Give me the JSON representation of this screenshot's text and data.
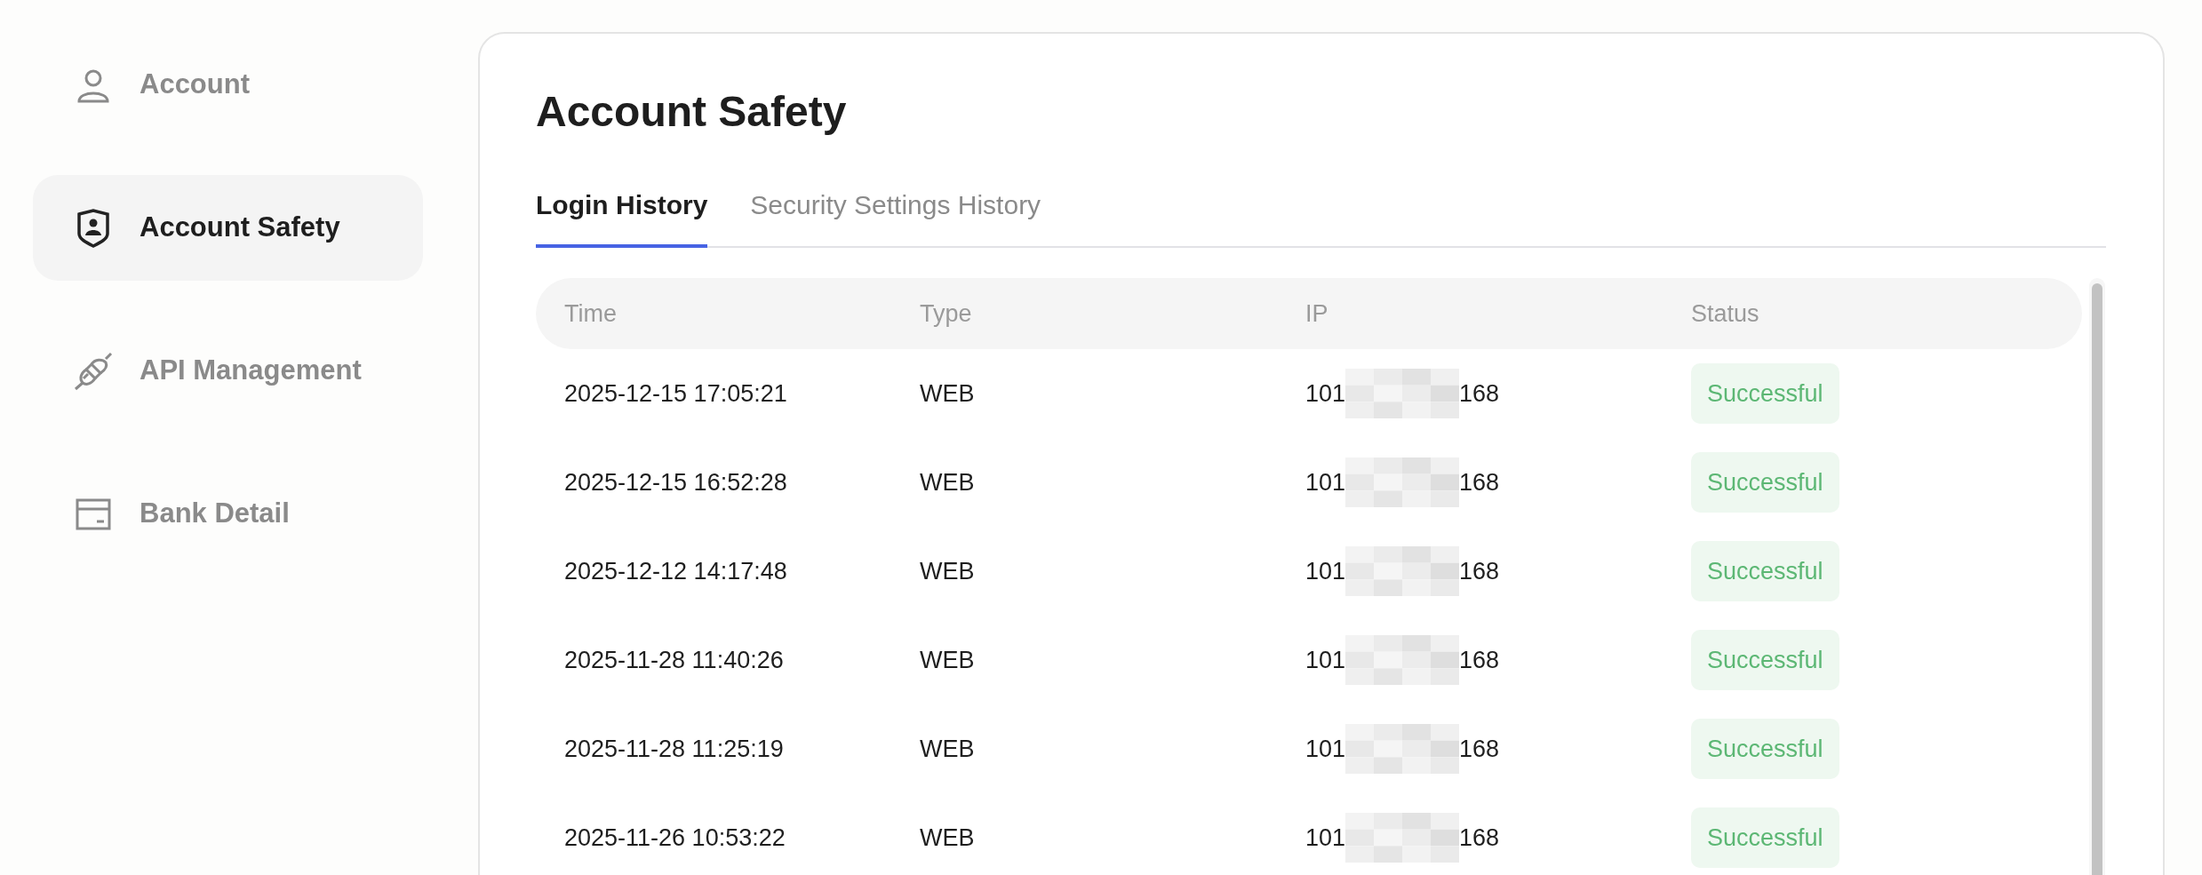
{
  "sidebar": {
    "items": [
      {
        "label": "Account",
        "selected": false
      },
      {
        "label": "Account Safety",
        "selected": true
      },
      {
        "label": "API Management",
        "selected": false
      },
      {
        "label": "Bank Detail",
        "selected": false
      }
    ]
  },
  "page": {
    "title": "Account Safety",
    "tabs": [
      {
        "label": "Login History",
        "selected": true
      },
      {
        "label": "Security Settings History",
        "selected": false
      }
    ],
    "table": {
      "columns": [
        "Time",
        "Type",
        "IP",
        "Status"
      ],
      "rows": [
        {
          "time": "2025-12-15 17:05:21",
          "type": "WEB",
          "ip_start": "101",
          "ip_end": "168",
          "status": "Successful"
        },
        {
          "time": "2025-12-15 16:52:28",
          "type": "WEB",
          "ip_start": "101",
          "ip_end": "168",
          "status": "Successful"
        },
        {
          "time": "2025-12-12 14:17:48",
          "type": "WEB",
          "ip_start": "101",
          "ip_end": "168",
          "status": "Successful"
        },
        {
          "time": "2025-11-28 11:40:26",
          "type": "WEB",
          "ip_start": "101",
          "ip_end": "168",
          "status": "Successful"
        },
        {
          "time": "2025-11-28 11:25:19",
          "type": "WEB",
          "ip_start": "101",
          "ip_end": "168",
          "status": "Successful"
        },
        {
          "time": "2025-11-26 10:53:22",
          "type": "WEB",
          "ip_start": "101",
          "ip_end": "168",
          "status": "Successful"
        }
      ]
    }
  }
}
